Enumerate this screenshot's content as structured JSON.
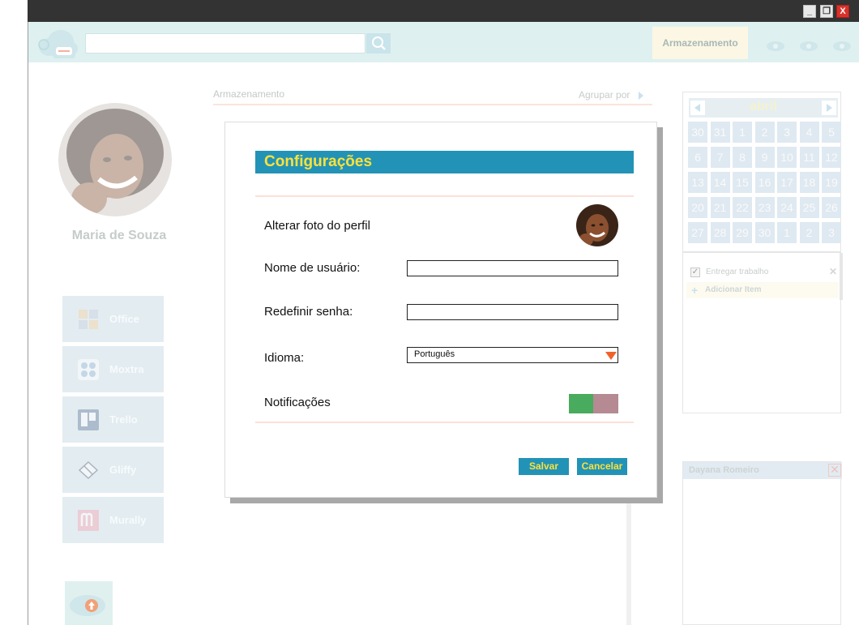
{
  "window": {
    "minimize_label": "_",
    "maximize_label": "❐",
    "close_label": "X",
    "colors": {
      "titlebar": "#333333",
      "close": "#d9322b"
    }
  },
  "header": {
    "search": {
      "value": "",
      "placeholder": ""
    },
    "storage_tab": "Armazenamento",
    "icons": [
      "search-icon",
      "cloud-icon",
      "info-icon",
      "settings-icon"
    ]
  },
  "profile": {
    "name": "Maria de Souza"
  },
  "apps": [
    {
      "label": "Office",
      "icon": "office-icon"
    },
    {
      "label": "Moxtra",
      "icon": "moxtra-icon"
    },
    {
      "label": "Trello",
      "icon": "trello-icon"
    },
    {
      "label": "Gliffy",
      "icon": "gliffy-icon"
    },
    {
      "label": "Murally",
      "icon": "murally-icon"
    }
  ],
  "main": {
    "section_label": "Armazenamento",
    "group_by_label": "Agrupar por"
  },
  "calendar": {
    "month": "abril",
    "days": [
      "30",
      "31",
      "1",
      "2",
      "3",
      "4",
      "5",
      "6",
      "7",
      "8",
      "9",
      "10",
      "11",
      "12",
      "13",
      "14",
      "15",
      "16",
      "17",
      "18",
      "19",
      "20",
      "21",
      "22",
      "23",
      "24",
      "25",
      "26",
      "27",
      "28",
      "29",
      "30",
      "1",
      "2",
      "3"
    ]
  },
  "tasks": {
    "items": [
      {
        "label": "Entregar trabalho",
        "checked": true
      }
    ],
    "add_label": "Adicionar Item"
  },
  "chat": {
    "contact_name": "Dayana Romeiro",
    "close_label": "✕"
  },
  "settings_modal": {
    "title": "Configurações",
    "change_photo_label": "Alterar foto do perfil",
    "username_label": "Nome de usuário:",
    "username_value": "",
    "password_label": "Redefinir senha:",
    "password_value": "",
    "language_label": "Idioma:",
    "language_value": "Português",
    "notifications_label": "Notificações",
    "notifications_enabled": true,
    "save_label": "Salvar",
    "cancel_label": "Cancelar",
    "colors": {
      "title_bg": "#2293b6",
      "title_text": "#fde13a",
      "toggle_on": "#49ab5d",
      "toggle_off": "#b58a92",
      "select_arrow": "#f0622a"
    }
  }
}
